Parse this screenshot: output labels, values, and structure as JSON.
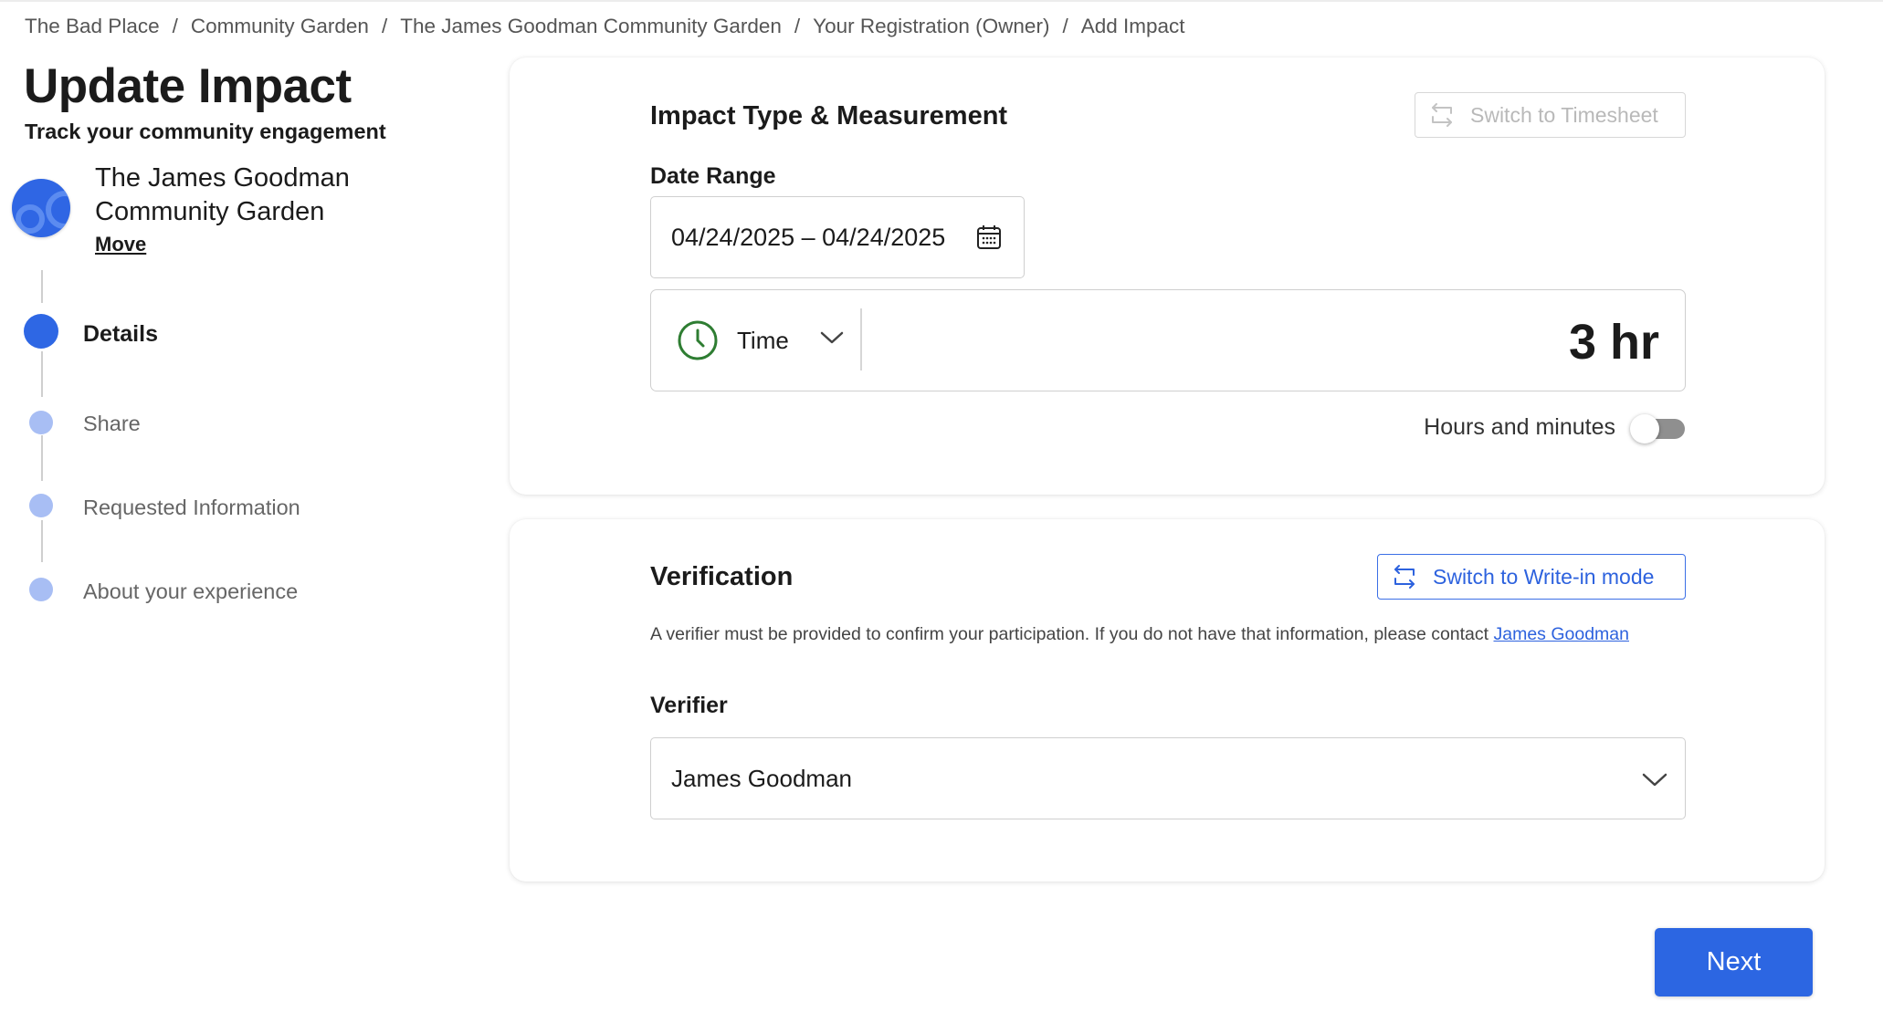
{
  "breadcrumb": [
    "The Bad Place",
    "Community Garden",
    "The James Goodman Community Garden",
    "Your Registration (Owner)",
    "Add Impact"
  ],
  "breadcrumb_separator": "/",
  "page": {
    "title": "Update Impact",
    "subtitle": "Track your community engagement"
  },
  "organization": {
    "name": "The James Goodman Community Garden",
    "move_label": "Move",
    "avatar_color": "#2f66e4"
  },
  "steps": [
    {
      "label": "Details",
      "active": true
    },
    {
      "label": "Share",
      "active": false
    },
    {
      "label": "Requested Information",
      "active": false
    },
    {
      "label": "About your experience",
      "active": false
    }
  ],
  "impact": {
    "section_title": "Impact Type & Measurement",
    "switch_label": "Switch to Timesheet",
    "date_range_label": "Date Range",
    "date_range_value": "04/24/2025 – 04/24/2025",
    "type_label": "Time",
    "type_icon": "clock-icon",
    "value": "3 hr",
    "toggle_label": "Hours and minutes",
    "toggle_on": false
  },
  "verification": {
    "section_title": "Verification",
    "switch_label": "Switch to Write-in mode",
    "description": "A verifier must be provided to confirm your participation. If you do not have that information, please contact ",
    "contact_name": "James Goodman",
    "verifier_label": "Verifier",
    "verifier_value": "James Goodman"
  },
  "actions": {
    "next_label": "Next"
  },
  "colors": {
    "primary": "#2c66e2",
    "step_inactive": "#a8bef4",
    "clock_green": "#2e7d32"
  }
}
